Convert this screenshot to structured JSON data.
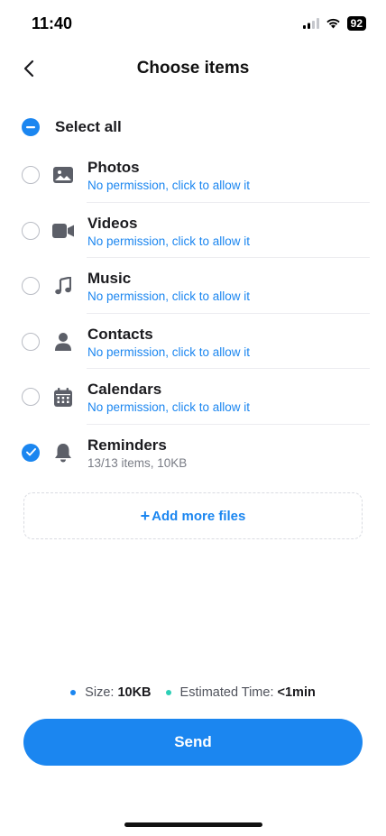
{
  "status": {
    "time": "11:40",
    "battery": "92"
  },
  "nav": {
    "title": "Choose items"
  },
  "select_all": {
    "label": "Select all"
  },
  "items": [
    {
      "title": "Photos",
      "subtitle": "No permission, click to allow it",
      "icon": "photo-icon",
      "checked": false
    },
    {
      "title": "Videos",
      "subtitle": "No permission, click to allow it",
      "icon": "video-icon",
      "checked": false
    },
    {
      "title": "Music",
      "subtitle": "No permission, click to allow it",
      "icon": "music-icon",
      "checked": false
    },
    {
      "title": "Contacts",
      "subtitle": "No permission, click to allow it",
      "icon": "contact-icon",
      "checked": false
    },
    {
      "title": "Calendars",
      "subtitle": "No permission, click to allow it",
      "icon": "calendar-icon",
      "checked": false
    },
    {
      "title": "Reminders",
      "subtitle": "13/13 items, 10KB",
      "icon": "bell-icon",
      "checked": true
    }
  ],
  "add_files": {
    "label": "Add more files"
  },
  "summary": {
    "size_label": "Size:",
    "size_value": "10KB",
    "time_label": "Estimated Time:",
    "time_value": "<1min",
    "size_dot_color": "#1b86f0",
    "time_dot_color": "#2ccfb6"
  },
  "send_label": "Send",
  "colors": {
    "accent": "#1b86f0",
    "icon_grey": "#5c5f68"
  }
}
